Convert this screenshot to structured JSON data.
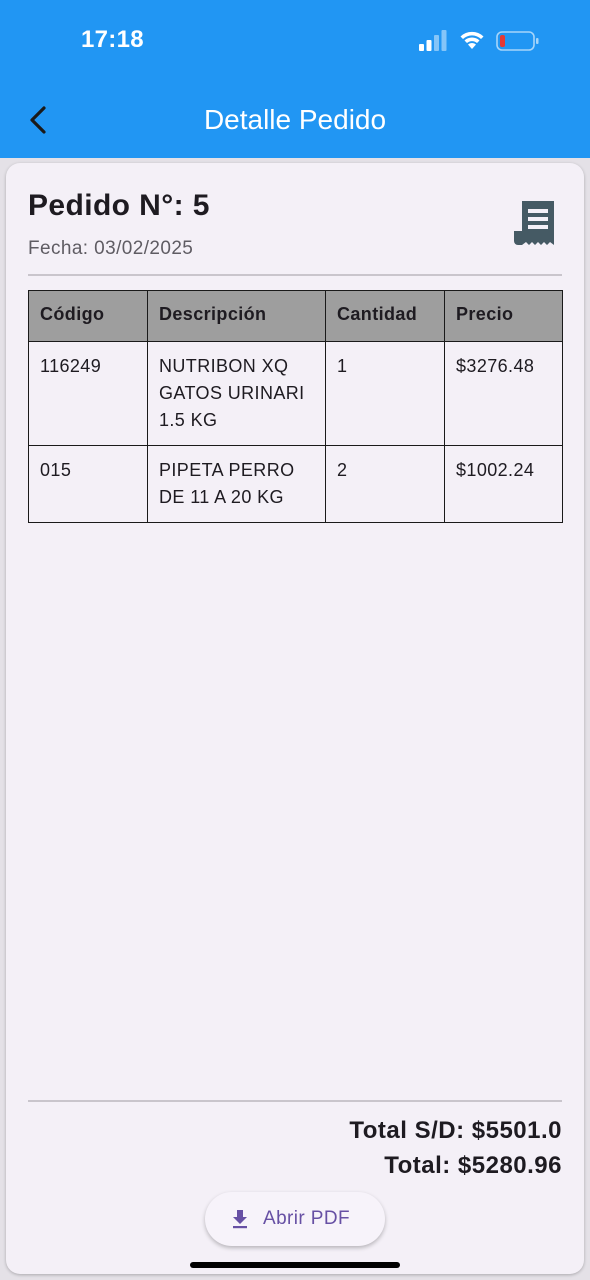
{
  "status_bar": {
    "time": "17:18",
    "icons": [
      "cellular-signal-icon",
      "wifi-icon",
      "battery-icon"
    ]
  },
  "app_bar": {
    "back_icon": "chevron-left-icon",
    "title": "Detalle Pedido",
    "color": "#2196f3"
  },
  "order": {
    "number_label": "Pedido N°: 5",
    "date_label": "Fecha: 03/02/2025",
    "icon": "receipt-icon"
  },
  "table": {
    "headers": [
      "Código",
      "Descripción",
      "Cantidad",
      "Precio"
    ],
    "rows": [
      [
        "116249",
        "NUTRIBON XQ GATOS URINARI 1.5 KG",
        "1",
        "$3276.48"
      ],
      [
        "015",
        "PIPETA PERRO DE 11 A 20 KG",
        "2",
        "$1002.24"
      ]
    ]
  },
  "totals": {
    "total_sd": "Total S/D: $5501.0",
    "total": "Total: $5280.96"
  },
  "pdf_button": {
    "icon": "download-icon",
    "label": "Abrir PDF",
    "color": "#6750a4"
  }
}
